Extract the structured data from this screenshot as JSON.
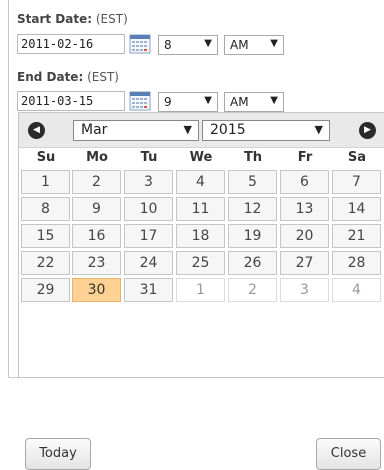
{
  "start": {
    "label_bold": "Start Date:",
    "label_suffix": "(EST)",
    "date_value": "2011-02-16",
    "hour": "8",
    "ampm": "AM"
  },
  "end": {
    "label_bold": "End Date:",
    "label_suffix": "(EST)",
    "date_value": "2011-03-15",
    "hour": "9",
    "ampm": "AM"
  },
  "calendar": {
    "month": "Mar",
    "year": "2015",
    "weekdays": [
      "Su",
      "Mo",
      "Tu",
      "We",
      "Th",
      "Fr",
      "Sa"
    ],
    "weeks": [
      [
        {
          "d": "1"
        },
        {
          "d": "2"
        },
        {
          "d": "3"
        },
        {
          "d": "4"
        },
        {
          "d": "5"
        },
        {
          "d": "6"
        },
        {
          "d": "7"
        }
      ],
      [
        {
          "d": "8"
        },
        {
          "d": "9"
        },
        {
          "d": "10"
        },
        {
          "d": "11"
        },
        {
          "d": "12"
        },
        {
          "d": "13"
        },
        {
          "d": "14"
        }
      ],
      [
        {
          "d": "15"
        },
        {
          "d": "16"
        },
        {
          "d": "17"
        },
        {
          "d": "18"
        },
        {
          "d": "19"
        },
        {
          "d": "20"
        },
        {
          "d": "21"
        }
      ],
      [
        {
          "d": "22"
        },
        {
          "d": "23"
        },
        {
          "d": "24"
        },
        {
          "d": "25"
        },
        {
          "d": "26"
        },
        {
          "d": "27"
        },
        {
          "d": "28"
        }
      ],
      [
        {
          "d": "29"
        },
        {
          "d": "30",
          "state": "selected"
        },
        {
          "d": "31"
        },
        {
          "d": "1",
          "state": "other"
        },
        {
          "d": "2",
          "state": "other"
        },
        {
          "d": "3",
          "state": "other"
        },
        {
          "d": "4",
          "state": "other"
        }
      ]
    ],
    "today_label": "Today",
    "close_label": "Close"
  },
  "icons": {
    "prev": "prev-month-icon",
    "next": "next-month-icon",
    "calendar": "calendar-icon",
    "dropdown": "dropdown-arrow-icon"
  },
  "colors": {
    "selected_day": "#ffd192",
    "header_bg": "#e9e9e9",
    "day_bg": "#f6f6f6"
  }
}
